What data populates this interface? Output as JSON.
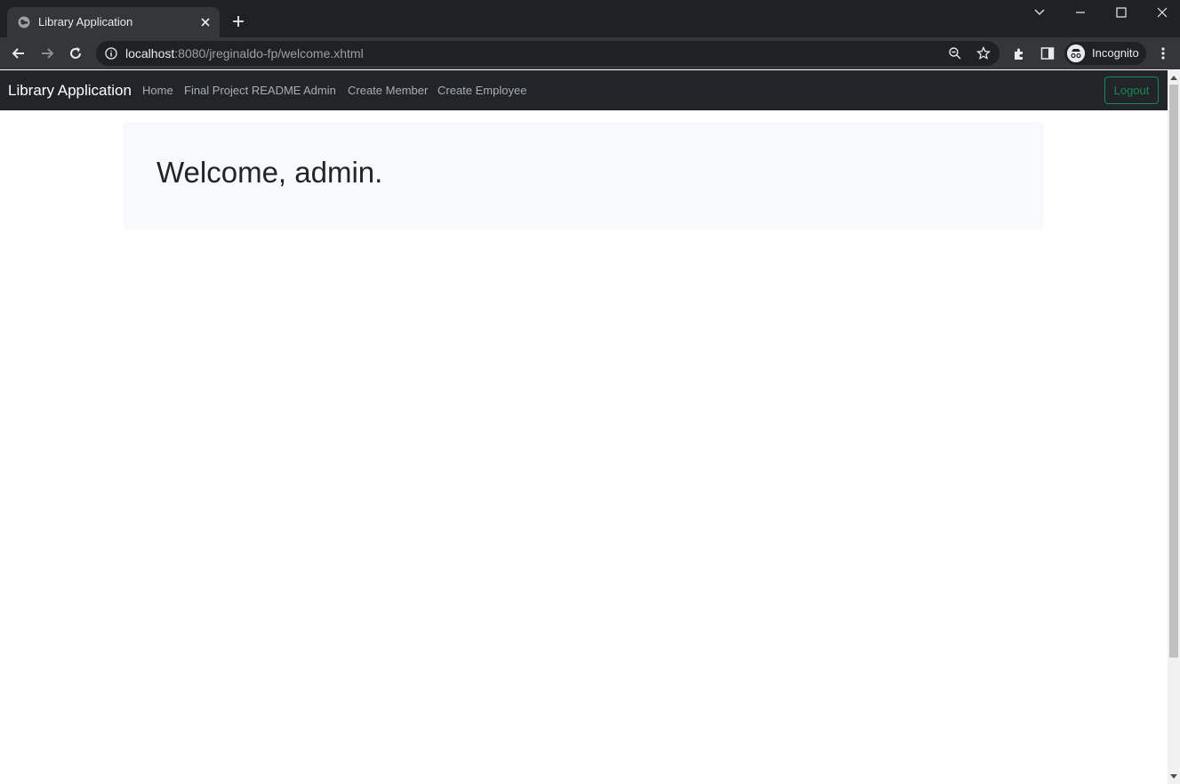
{
  "browser": {
    "tab_title": "Library Application",
    "url_host": "localhost",
    "url_rest": ":8080/jreginaldo-fp/welcome.xhtml",
    "profile_label": "Incognito"
  },
  "navbar": {
    "brand": "Library Application",
    "links": [
      "Home",
      "Final Project README",
      "Admin",
      "Create Member",
      "Create Employee"
    ],
    "logout_label": "Logout"
  },
  "main": {
    "welcome_heading": "Welcome, admin."
  },
  "colors": {
    "navbar_bg": "#212529",
    "logout_outline": "#198754",
    "jumbotron_bg": "#f8f9fa"
  }
}
